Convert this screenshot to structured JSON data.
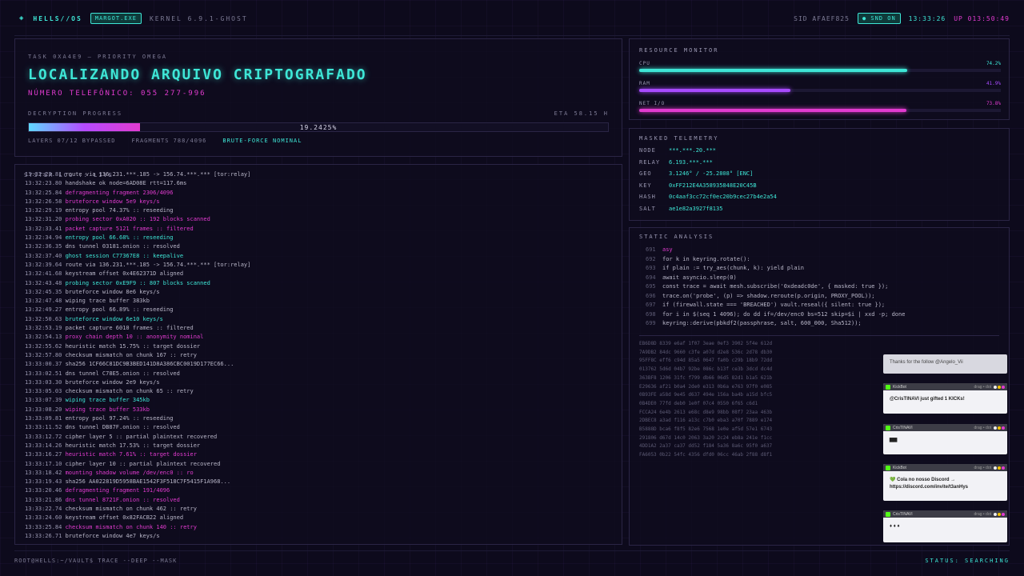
{
  "header": {
    "brand": "HELLS//OS",
    "user_chip": "MARGOT.EXE",
    "kernel": "KERNEL 6.9.1-GHOST",
    "sid": "SID AFAEF825",
    "snd_chip": "SND ON",
    "clock": "13:33:26",
    "uptime": "UP 013:50:49"
  },
  "task": {
    "subtitle": "TASK 0XA4E9 — PRIORITY OMEGA",
    "title": "LOCALIZANDO ARQUIVO CRIPTOGRAFADO",
    "phone": "NÚMERO TELEFÔNICO: 055 277-996",
    "progress_label": "DECRYPTION PROGRESS",
    "eta": "ETA 58.15 H",
    "progress_text": "19.2425%",
    "progress_value": 19.2425,
    "layers": "LAYERS 07/12 BYPASSED",
    "fragments": "FRAGMENTS 788/4096",
    "mode": "BRUTE-FORCE NOMINAL"
  },
  "log": {
    "title": "SYSTEM LOG :: LIVE",
    "entries": [
      {
        "t": "13:32:22.81",
        "m": "route via 136.231.***.185 -> 156.74.***.*** [tor:relay]",
        "c": "w"
      },
      {
        "t": "13:32:23.80",
        "m": "handshake ok node=6AD08E rtt=117.6ms",
        "c": "w"
      },
      {
        "t": "13:32:25.84",
        "m": "defragmenting fragment 2306/4096",
        "c": "m"
      },
      {
        "t": "13:32:26.58",
        "m": "bruteforce window 5e9 keys/s",
        "c": "m"
      },
      {
        "t": "13:32:29.19",
        "m": "entropy pool 74.37% :: reseeding",
        "c": "w"
      },
      {
        "t": "13:32:31.20",
        "m": "probing sector 0xA020 :: 192 blocks scanned",
        "c": "m"
      },
      {
        "t": "13:32:33.41",
        "m": "packet capture 5121 frames :: filtered",
        "c": "m"
      },
      {
        "t": "13:32:34.94",
        "m": "entropy pool 66.68% :: reseeding",
        "c": "c"
      },
      {
        "t": "13:32:36.35",
        "m": "dns tunnel 03181.onion :: resolved",
        "c": "w"
      },
      {
        "t": "13:32:37.40",
        "m": "ghost session C77367E8 :: keepalive",
        "c": "c"
      },
      {
        "t": "13:32:39.64",
        "m": "route via 136.231.***.185 -> 156.74.***.*** [tor:relay]",
        "c": "w"
      },
      {
        "t": "13:32:41.68",
        "m": "keystream offset 0x4E62371D aligned",
        "c": "w"
      },
      {
        "t": "13:32:43.48",
        "m": "probing sector 0xE9F9 :: 807 blocks scanned",
        "c": "c"
      },
      {
        "t": "13:32:45.35",
        "m": "bruteforce window 8e6 keys/s",
        "c": "w"
      },
      {
        "t": "13:32:47.48",
        "m": "wiping trace buffer 383kb",
        "c": "w"
      },
      {
        "t": "13:32:49.27",
        "m": "entropy pool 66.89% :: reseeding",
        "c": "w"
      },
      {
        "t": "13:32:50.63",
        "m": "bruteforce window 6e10 keys/s",
        "c": "c"
      },
      {
        "t": "13:32:53.19",
        "m": "packet capture 6010 frames :: filtered",
        "c": "w"
      },
      {
        "t": "13:32:54.13",
        "m": "proxy chain depth 10 :: anonymity nominal",
        "c": "m"
      },
      {
        "t": "13:32:55.62",
        "m": "heuristic match 15.75% :: target dossier",
        "c": "w"
      },
      {
        "t": "13:32:57.80",
        "m": "checksum mismatch on chunk 167 :: retry",
        "c": "w"
      },
      {
        "t": "13:33:00.37",
        "m": "sha256 1CF66C81DC9B3BED141D8A386CBC0019D177EC66...",
        "c": "w"
      },
      {
        "t": "13:33:02.51",
        "m": "dns tunnel C78E5.onion :: resolved",
        "c": "w"
      },
      {
        "t": "13:33:03.30",
        "m": "bruteforce window 2e9 keys/s",
        "c": "w"
      },
      {
        "t": "13:33:05.03",
        "m": "checksum mismatch on chunk 65 :: retry",
        "c": "w"
      },
      {
        "t": "13:33:07.39",
        "m": "wiping trace buffer 345kb",
        "c": "c"
      },
      {
        "t": "13:33:08.20",
        "m": "wiping trace buffer 533kb",
        "c": "m"
      },
      {
        "t": "13:33:09.81",
        "m": "entropy pool 97.24% :: reseeding",
        "c": "w"
      },
      {
        "t": "13:33:11.52",
        "m": "dns tunnel DB87F.onion :: resolved",
        "c": "w"
      },
      {
        "t": "13:33:12.72",
        "m": "cipher layer 5 :: partial plaintext recovered",
        "c": "w"
      },
      {
        "t": "13:33:14.26",
        "m": "heuristic match 17.53% :: target dossier",
        "c": "w"
      },
      {
        "t": "13:33:16.27",
        "m": "heuristic match 7.61% :: target dossier",
        "c": "m"
      },
      {
        "t": "13:33:17.10",
        "m": "cipher layer 10 :: partial plaintext recovered",
        "c": "w"
      },
      {
        "t": "13:33:18.42",
        "m": "mounting shadow volume /dev/enc0 :: ro",
        "c": "m"
      },
      {
        "t": "13:33:19.43",
        "m": "sha256 AA022819D5958BAE1542F3F518C7F5415F1A968...",
        "c": "w"
      },
      {
        "t": "13:33:20.46",
        "m": "defragmenting fragment 191/4096",
        "c": "m"
      },
      {
        "t": "13:33:21.86",
        "m": "dns tunnel 8721F.onion :: resolved",
        "c": "m"
      },
      {
        "t": "13:33:22.74",
        "m": "checksum mismatch on chunk 462 :: retry",
        "c": "w"
      },
      {
        "t": "13:33:24.60",
        "m": "keystream offset 0x82FACB22 aligned",
        "c": "w"
      },
      {
        "t": "13:33:25.84",
        "m": "checksum mismatch on chunk 140 :: retry",
        "c": "m"
      },
      {
        "t": "13:33:26.71",
        "m": "bruteforce window 4e7 keys/s",
        "c": "w"
      }
    ]
  },
  "resources": {
    "title": "RESOURCE MONITOR",
    "meters": [
      {
        "label": "CPU",
        "value_text": "74.2%",
        "value": 74.2,
        "color": "#3ee6d6"
      },
      {
        "label": "RAM",
        "value_text": "41.9%",
        "value": 41.9,
        "color": "#a84bff"
      },
      {
        "label": "NET I/O",
        "value_text": "73.8%",
        "value": 73.8,
        "color": "#e23bd0"
      }
    ]
  },
  "telemetry": {
    "title": "MASKED TELEMETRY",
    "rows": [
      {
        "k": "NODE",
        "v": "***.***.20.***"
      },
      {
        "k": "RELAY",
        "v": "6.193.***.***"
      },
      {
        "k": "GEO",
        "v": "3.1246° / -25.2808° [ENC]"
      },
      {
        "k": "KEY",
        "v": "0xFF212E4A358935848E20C45B"
      },
      {
        "k": "HASH",
        "v": "0c4aaf3cc72cf0ec20b9cec27b4e2a54"
      },
      {
        "k": "SALT",
        "v": "ae1e82a3927f8135"
      }
    ]
  },
  "static": {
    "title": "STATIC ANALYSIS",
    "code": [
      {
        "n": "691",
        "t": "asy",
        "hl": true
      },
      {
        "n": "692",
        "t": "for k in keyring.rotate():",
        "hl": false
      },
      {
        "n": "693",
        "t": "if plain := try_aes(chunk, k): yield plain",
        "hl": false
      },
      {
        "n": "694",
        "t": "await asyncio.sleep(0)",
        "hl": false
      },
      {
        "n": "695",
        "t": "const trace = await mesh.subscribe('0xdeadc0de', { masked: true });",
        "hl": false
      },
      {
        "n": "696",
        "t": "trace.on('probe', (p) => shadow.reroute(p.origin, PROXY_POOL));",
        "hl": false
      },
      {
        "n": "697",
        "t": "if (firewall.state === 'BREACHED') vault.reseal({ silent: true });",
        "hl": false
      },
      {
        "n": "698",
        "t": "for i in $(seq 1 4096); do dd if=/dev/enc0 bs=512 skip=$i | xxd -p; done",
        "hl": false
      },
      {
        "n": "699",
        "t": "keyring::derive(pbkdf2(passphrase, salt, 600_000, Sha512));",
        "hl": false
      }
    ],
    "hex": [
      "EB6D8D 8339 e6af 1f07 3eae 0ef3 3902 5f4e 612d",
      "7A9DB2 84dc 9660 c3fe a07d d2e8 536c 2d78 db30",
      "95FF8C eff6 c94d 85a5 0647 fa0b c29b 18b9 72dd",
      "013762 5d6d 04b7 92be 086c b13f ce3b 3dcd dc4d",
      "363BF8 1206 31fc f799 db66 06d5 82d1 b1a5 621b",
      "E29636 af21 b0a4 2de0 e313 0b6a e763 97f0 e085",
      "0B93FE a58d 9e45 d637 494e 156a ba4b a15d bfc5",
      "0B4DE0 77fd deb0 1e0f 07c4 0550 6f65 c6d1",
      "FCCA24 6e4b 2613 e68c d8e9 98bb 08f7 23aa 463b",
      "2DBEC8 a3ad f116 a13c c7b0 eba3 a70f 7889 e174",
      "B5888D bca6 f8f5 82e6 7568 1e0e af5d 57e1 6743",
      "291806 d67d 14c0 2063 3a20 2c24 eb8a 241e f1cc",
      "4DD1A2 2a37 ca37 dd52 f184 5a36 8a6c 95f0 a637",
      "FA6053 0b22 54fc 4356 dfd0 06cc 46ab 2f88 d8f1"
    ]
  },
  "chat": [
    {
      "user": "",
      "meta": "",
      "text": "Thanks for the follow @Angelo_Vii"
    },
    {
      "user": "KickBot",
      "meta": "drag • dot",
      "text": "@CrisTINAVI just gifted 1 KICKs!"
    },
    {
      "user": "CrisTINAVI",
      "meta": "drag • dot",
      "text": "▆▆"
    },
    {
      "user": "KickBot",
      "meta": "drag • dot",
      "text": "💚 Cola no nosso Discord → https://discord.com/invite/t3anHys"
    },
    {
      "user": "CrisTINAVI",
      "meta": "drag • dot",
      "text": "♦ ♦ ♦"
    }
  ],
  "footer": {
    "prompt": "ROOT@HELLS:~/VAULT$ TRACE --DEEP --MASK",
    "status": "STATUS: SEARCHING"
  },
  "colors": {
    "cyan": "#3ee6d6",
    "magenta": "#e23bd0",
    "violet": "#a84bff",
    "bg": "#0d0a1c"
  }
}
